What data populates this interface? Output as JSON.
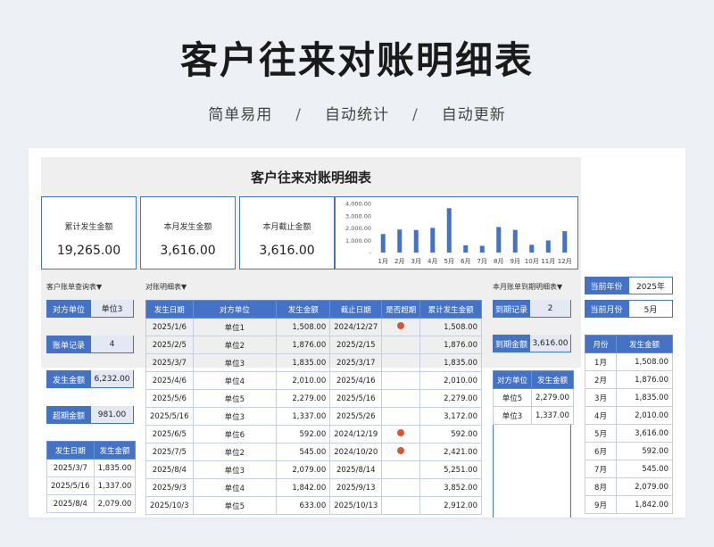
{
  "hero": {
    "title": "客户往来对账明细表",
    "subtitle_items": [
      "简单易用",
      "自动统计",
      "自动更新"
    ],
    "separator": "/"
  },
  "sheet": {
    "title": "客户往来对账明细表"
  },
  "kpis": [
    {
      "label": "累计发生金额",
      "value": "19,265.00"
    },
    {
      "label": "本月发生金额",
      "value": "3,616.00"
    },
    {
      "label": "本月截止金额",
      "value": "3,616.00"
    }
  ],
  "chart_data": {
    "type": "bar",
    "categories": [
      "1月",
      "2月",
      "3月",
      "4月",
      "5月",
      "6月",
      "7月",
      "8月",
      "9月",
      "10月",
      "11月",
      "12月"
    ],
    "values": [
      1508,
      1876,
      1835,
      2010,
      3616,
      592,
      545,
      2079,
      1842,
      633,
      983,
      1740
    ],
    "ylim": [
      0,
      4000
    ],
    "yticks": [
      "4,000.00",
      "3,000.00",
      "2,000.00",
      "1,000.00",
      "-"
    ],
    "color": "#4472c4",
    "grid": false,
    "legend": "none"
  },
  "left_panel": {
    "section_label": "客户账单查询表▼",
    "filter_label": "对方单位",
    "filter_value": "单位3",
    "records_label": "账单记录",
    "records_value": "4",
    "amount_label": "发生金额",
    "amount_value": "6,232.00",
    "overdue_label": "超期金额",
    "overdue_value": "981.00",
    "headers": [
      "发生日期",
      "发生金额"
    ],
    "rows": [
      [
        "2025/3/7",
        "1,835.00"
      ],
      [
        "2025/5/16",
        "1,337.00"
      ],
      [
        "2025/8/4",
        "2,079.00"
      ]
    ]
  },
  "detail": {
    "section_label": "对账明细表▼",
    "headers": [
      "发生日期",
      "对方单位",
      "发生金额",
      "截止日期",
      "是否超期",
      "累计发生金额"
    ],
    "rows": [
      [
        "2025/1/6",
        "单位1",
        "1,508.00",
        "2024/12/27",
        true,
        "1,508.00"
      ],
      [
        "2025/2/5",
        "单位2",
        "1,876.00",
        "2025/2/15",
        false,
        "1,876.00"
      ],
      [
        "2025/3/7",
        "单位3",
        "1,835.00",
        "2025/3/17",
        false,
        "1,835.00"
      ],
      [
        "2025/4/6",
        "单位4",
        "2,010.00",
        "2025/4/16",
        false,
        "2,010.00"
      ],
      [
        "2025/5/6",
        "单位5",
        "2,279.00",
        "2025/5/16",
        false,
        "2,279.00"
      ],
      [
        "2025/5/16",
        "单位3",
        "1,337.00",
        "2025/5/26",
        false,
        "3,172.00"
      ],
      [
        "2025/6/5",
        "单位6",
        "592.00",
        "2024/12/19",
        true,
        "592.00"
      ],
      [
        "2025/7/5",
        "单位2",
        "545.00",
        "2024/10/20",
        true,
        "2,421.00"
      ],
      [
        "2025/8/4",
        "单位3",
        "2,079.00",
        "2025/8/14",
        false,
        "5,251.00"
      ],
      [
        "2025/9/3",
        "单位4",
        "1,842.00",
        "2025/9/13",
        false,
        "3,852.00"
      ],
      [
        "2025/10/3",
        "单位5",
        "633.00",
        "2025/10/13",
        false,
        "2,912.00"
      ]
    ]
  },
  "due_panel": {
    "section_label": "本月账单到期明细表▼",
    "due_label": "到期记录",
    "due_value": "2",
    "amount_label": "到期金额",
    "amount_value": "3,616.00",
    "headers": [
      "对方单位",
      "发生金额"
    ],
    "rows": [
      [
        "单位5",
        "2,279.00"
      ],
      [
        "单位3",
        "1,337.00"
      ]
    ]
  },
  "month_panel": {
    "year_label": "当前年份",
    "year_value": "2025年",
    "month_label": "当前月份",
    "month_value": "5月",
    "headers": [
      "月份",
      "发生金额"
    ],
    "rows": [
      [
        "1月",
        "1,508.00"
      ],
      [
        "2月",
        "1,876.00"
      ],
      [
        "3月",
        "1,835.00"
      ],
      [
        "4月",
        "2,010.00"
      ],
      [
        "5月",
        "3,616.00"
      ],
      [
        "6月",
        "592.00"
      ],
      [
        "7月",
        "545.00"
      ],
      [
        "8月",
        "2,079.00"
      ],
      [
        "9月",
        "1,842.00"
      ]
    ]
  }
}
